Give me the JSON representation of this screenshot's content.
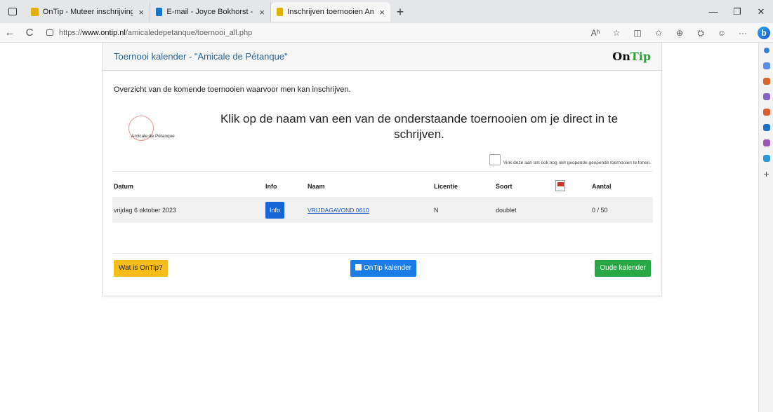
{
  "browser": {
    "tabs": [
      {
        "title": "OnTip - Muteer inschrijvingen",
        "close": "×",
        "favicon_color": "#e0b100"
      },
      {
        "title": "E-mail - Joyce Bokhorst - Outloo",
        "close": "×",
        "favicon_color": "#1a73c8"
      },
      {
        "title": "Inschrijven toernooien Amicale d",
        "close": "×",
        "favicon_color": "#e0b100"
      }
    ],
    "new_tab": "+",
    "window_controls": {
      "minimize": "—",
      "restore": "❐",
      "close": "✕"
    },
    "address": {
      "prefix": "https://",
      "host": "www.ontip.nl",
      "path": "/amicaledepetanque/toernooi_all.php"
    },
    "nav": {
      "back": "←",
      "reload": "C"
    },
    "toolbar_icons": [
      "Aʱ",
      "☆",
      "◫",
      "✩",
      "⊕",
      "⛭",
      "☺",
      "···"
    ],
    "edge_icon": "b"
  },
  "page": {
    "title": "Toernooi kalender - \"Amicale de Pétanque\"",
    "logo_on": "On",
    "logo_tip": "Tip",
    "intro": "Overzicht van de komende toernooien waarvoor men kan inschrijven.",
    "club_name": "Amicale de Pétanque",
    "headline": "Klik op de naam van een van de onderstaande toernooien om je direct in te schrijven.",
    "checkbox_label": "Vink deze aan om ook nog niet geopende geopende toernooien te tonen.",
    "table": {
      "headers": {
        "datum": "Datum",
        "info": "Info",
        "naam": "Naam",
        "licentie": "Licentie",
        "soort": "Soort",
        "aantal": "Aantal"
      },
      "rows": [
        {
          "datum": "vrijdag 6 oktober 2023",
          "info": "Info",
          "naam": "VRIJDAGAVOND 0610",
          "licentie": "N",
          "soort": "doublet",
          "aantal": "0 / 50"
        }
      ]
    },
    "buttons": {
      "wat_is": "Wat is OnTip?",
      "kalender": "OnTip kalender",
      "oude": "Oude kalender"
    }
  },
  "colors": {
    "accent_blue": "#1565d6",
    "warning": "#f7bd1a",
    "success": "#28a745",
    "title_blue": "#2a6496"
  }
}
